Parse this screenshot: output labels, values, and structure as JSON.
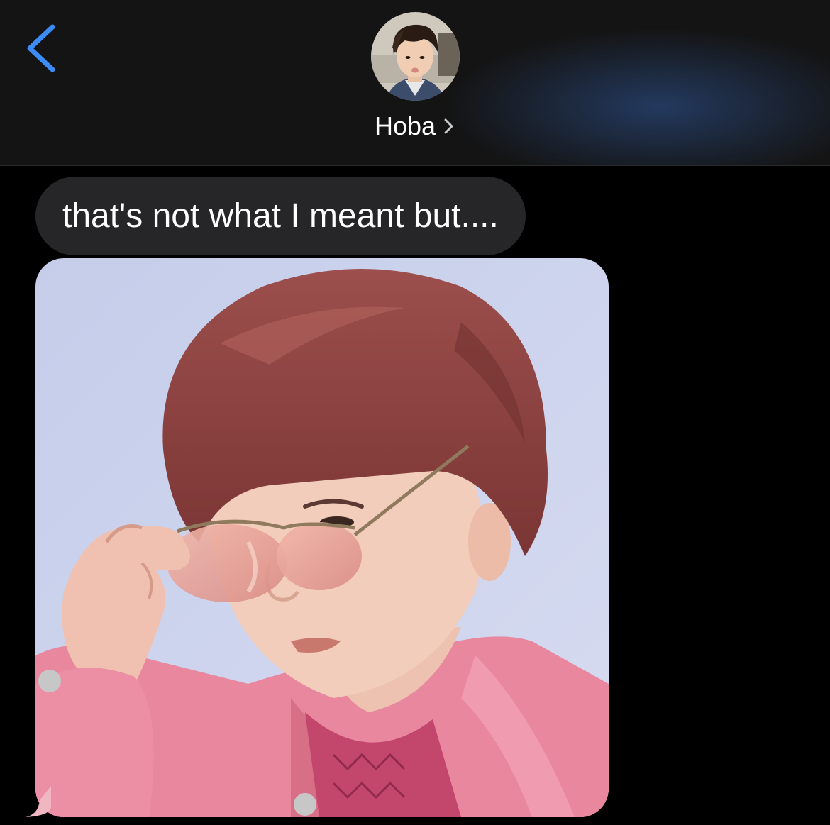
{
  "header": {
    "back_icon": "chevron-left-icon",
    "contact_name": "Hoba",
    "chevron_icon": "chevron-right-icon",
    "accent_color": "#3b8cf7"
  },
  "messages": [
    {
      "type": "text",
      "direction": "incoming",
      "text": "that's not what I meant but...."
    },
    {
      "type": "image",
      "direction": "incoming"
    }
  ],
  "colors": {
    "background": "#000000",
    "header_background": "#141414",
    "incoming_bubble": "#262628",
    "text": "#ffffff"
  }
}
